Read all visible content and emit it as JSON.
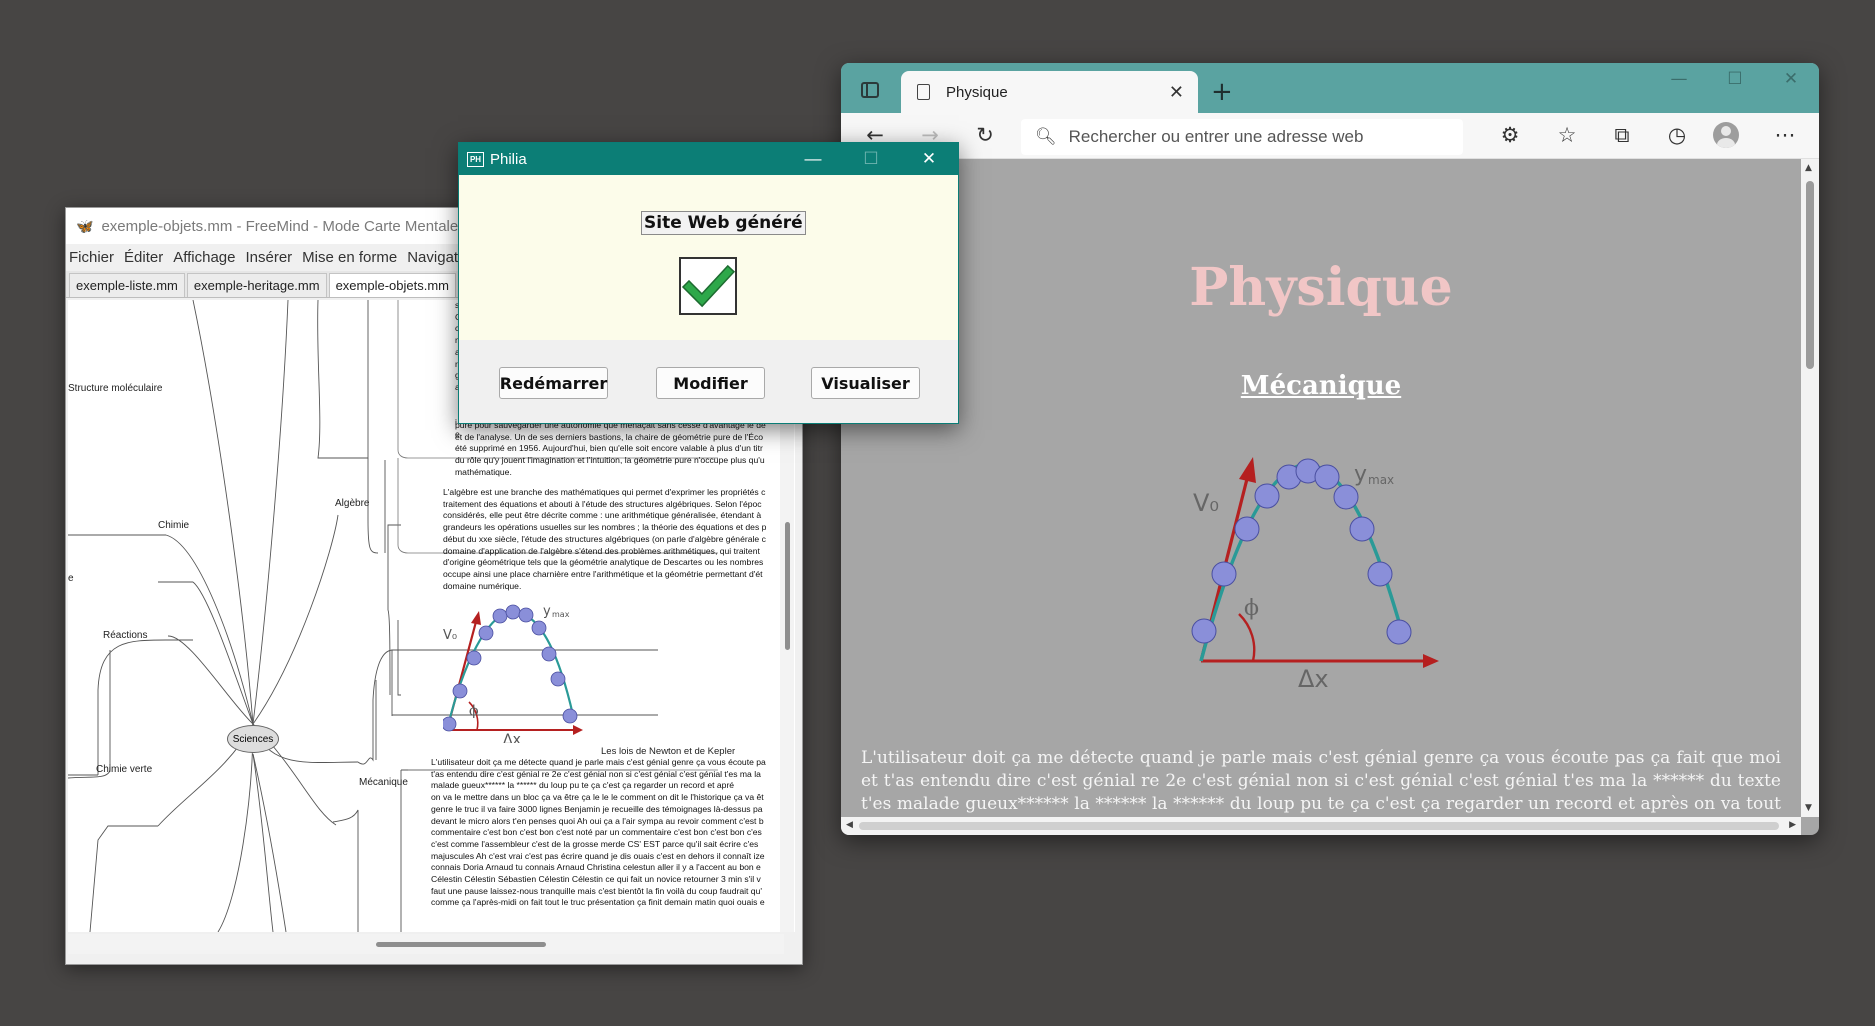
{
  "freemind": {
    "title": "exemple-objets.mm - FreeMind - Mode Carte Mentale",
    "menu": [
      "Fichier",
      "Éditer",
      "Affichage",
      "Insérer",
      "Mise en forme",
      "Navigatio"
    ],
    "tabs": [
      "exemple-liste.mm",
      "exemple-heritage.mm",
      "exemple-objets.mm"
    ],
    "active_tab": 2,
    "nodes": {
      "root": "Sciences",
      "structure": "Structure moléculaire",
      "chimie": "Chimie",
      "reactions": "Réactions",
      "chimie_verte": "Chimie verte",
      "algebre": "Algèbre",
      "mecanique": "Mécanique",
      "newton": "Les lois de Newton et de Kepler",
      "left_mark": "e"
    },
    "top_left_letters": [
      "s",
      "C",
      "c",
      "n",
      "a",
      "r",
      "g",
      "a",
      "t",
      "d",
      "v",
      "l",
      "i",
      "e"
    ],
    "geometry_text": [
      "pure pour sauvegarder une autonomie que menaçait sans cesse d'avantage le dé",
      "et de l'analyse. Un de ses derniers bastions, la chaire de géométrie pure de l'Éco",
      "été supprimé en 1956. Aujourd'hui, bien qu'elle soit encore valable à plus d'un titr",
      "du rôle qu'y jouent l'imagination et l'intuition, la géométrie pure n'occupe plus qu'u",
      "mathématique."
    ],
    "algebre_text": [
      "L'algèbre est une branche des mathématiques qui permet d'exprimer les propriétés c",
      "traitement des équations et abouti à l'étude des structures algébriques. Selon l'époc",
      "considérés, elle peut être décrite comme : une arithmétique généralisée, étendant à",
      "grandeurs les opérations usuelles sur les nombres ; la théorie des équations et des p",
      "début du xxe siècle, l'étude des structures algébriques (on parle d'algèbre générale c",
      "domaine d'application de l'algèbre s'étend des problèmes arithmétiques, qui traitent",
      "d'origine géométrique tels que la géométrie analytique de Descartes ou les nombres",
      "occupe ainsi une place charnière entre l'arithmétique et la géométrie permettant d'ét",
      "domaine numérique."
    ],
    "mecanique_text": [
      "L'utilisateur doit ça me détecte quand je parle mais c'est génial genre ça vous écoute pa",
      "t'as entendu dire c'est génial re 2e c'est génial non si c'est génial c'est génial t'es ma la",
      "malade gueux****** la ****** du loup pu te ça c'est ça regarder un record et apré",
      "on va le mettre dans un bloc ça va être ça le le le comment on dit le l'historique ça va êt",
      "genre le truc il va faire 3000 lignes Benjamin je recueille des témoignages là-dessus pa",
      "devant le micro alors t'en penses quoi Ah oui ça a l'air sympa au revoir comment c'est b",
      "commentaire c'est bon c'est bon c'est noté par un commentaire c'est bon c'est bon c'es",
      "c'est comme l'assembleur c'est de la grosse merde CS' EST parce qu'il sait écrire c'es",
      "majuscules Ah c'est vrai c'est pas écrire quand je dis ouais c'est en dehors il connaît ize",
      "connais Doria Arnaud tu connais Arnaud Christina celestun aller il y a l'accent au bon e",
      "Célestin Célestin Sébastien Célestin Célestin ce qui fait un novice retourner 3 min s'il v",
      "faut une pause laissez-nous tranquille mais c'est bientôt la fin voilà du coup faudrait qu'",
      "comme ça l'après-midi on fait tout le truc présentation ça finit demain matin quoi ouais e"
    ],
    "diagram_labels": {
      "v0": "V₀",
      "ymax": "y",
      "ymax_sub": "max",
      "phi": "ϕ",
      "dx": "Δx"
    }
  },
  "philia": {
    "title": "Philia",
    "icon_text": "PH",
    "heading": "Site Web généré",
    "buttons": {
      "restart": "Redémarrer",
      "modify": "Modifier",
      "view": "Visualiser"
    },
    "controls": {
      "minimize": "—",
      "maximize": "☐",
      "close": "✕"
    }
  },
  "edge": {
    "tab_title": "Physique",
    "tab_close": "✕",
    "new_tab": "+",
    "address_placeholder": "Rechercher ou entrer une adresse web",
    "window_controls": {
      "minimize": "—",
      "maximize": "☐",
      "close": "✕"
    },
    "page": {
      "title": "Physique",
      "subtitle": "Mécanique",
      "paragraph": "L'utilisateur doit ça me détecte quand je parle mais c'est génial genre ça vous écoute pas ça fait que moi et t'as entendu dire c'est génial re 2e c'est génial non si c'est génial c'est génial t'es ma la ****** du texte t'es malade gueux****** la ****** la ****** du loup pu te ça c'est ça regarder un record et après on va tout traiter et on va"
    },
    "diagram_labels": {
      "v0": "V₀",
      "ymax": "y",
      "ymax_sub": "max",
      "phi": "ϕ",
      "dx": "Δx"
    }
  },
  "colors": {
    "desktop": "#474544",
    "philia_teal": "#0c7e76",
    "edge_teal": "#5aa3a1",
    "page_bg": "#a6a6a6",
    "title_pink": "#f1c6c6",
    "check_green": "#2ea84a"
  }
}
